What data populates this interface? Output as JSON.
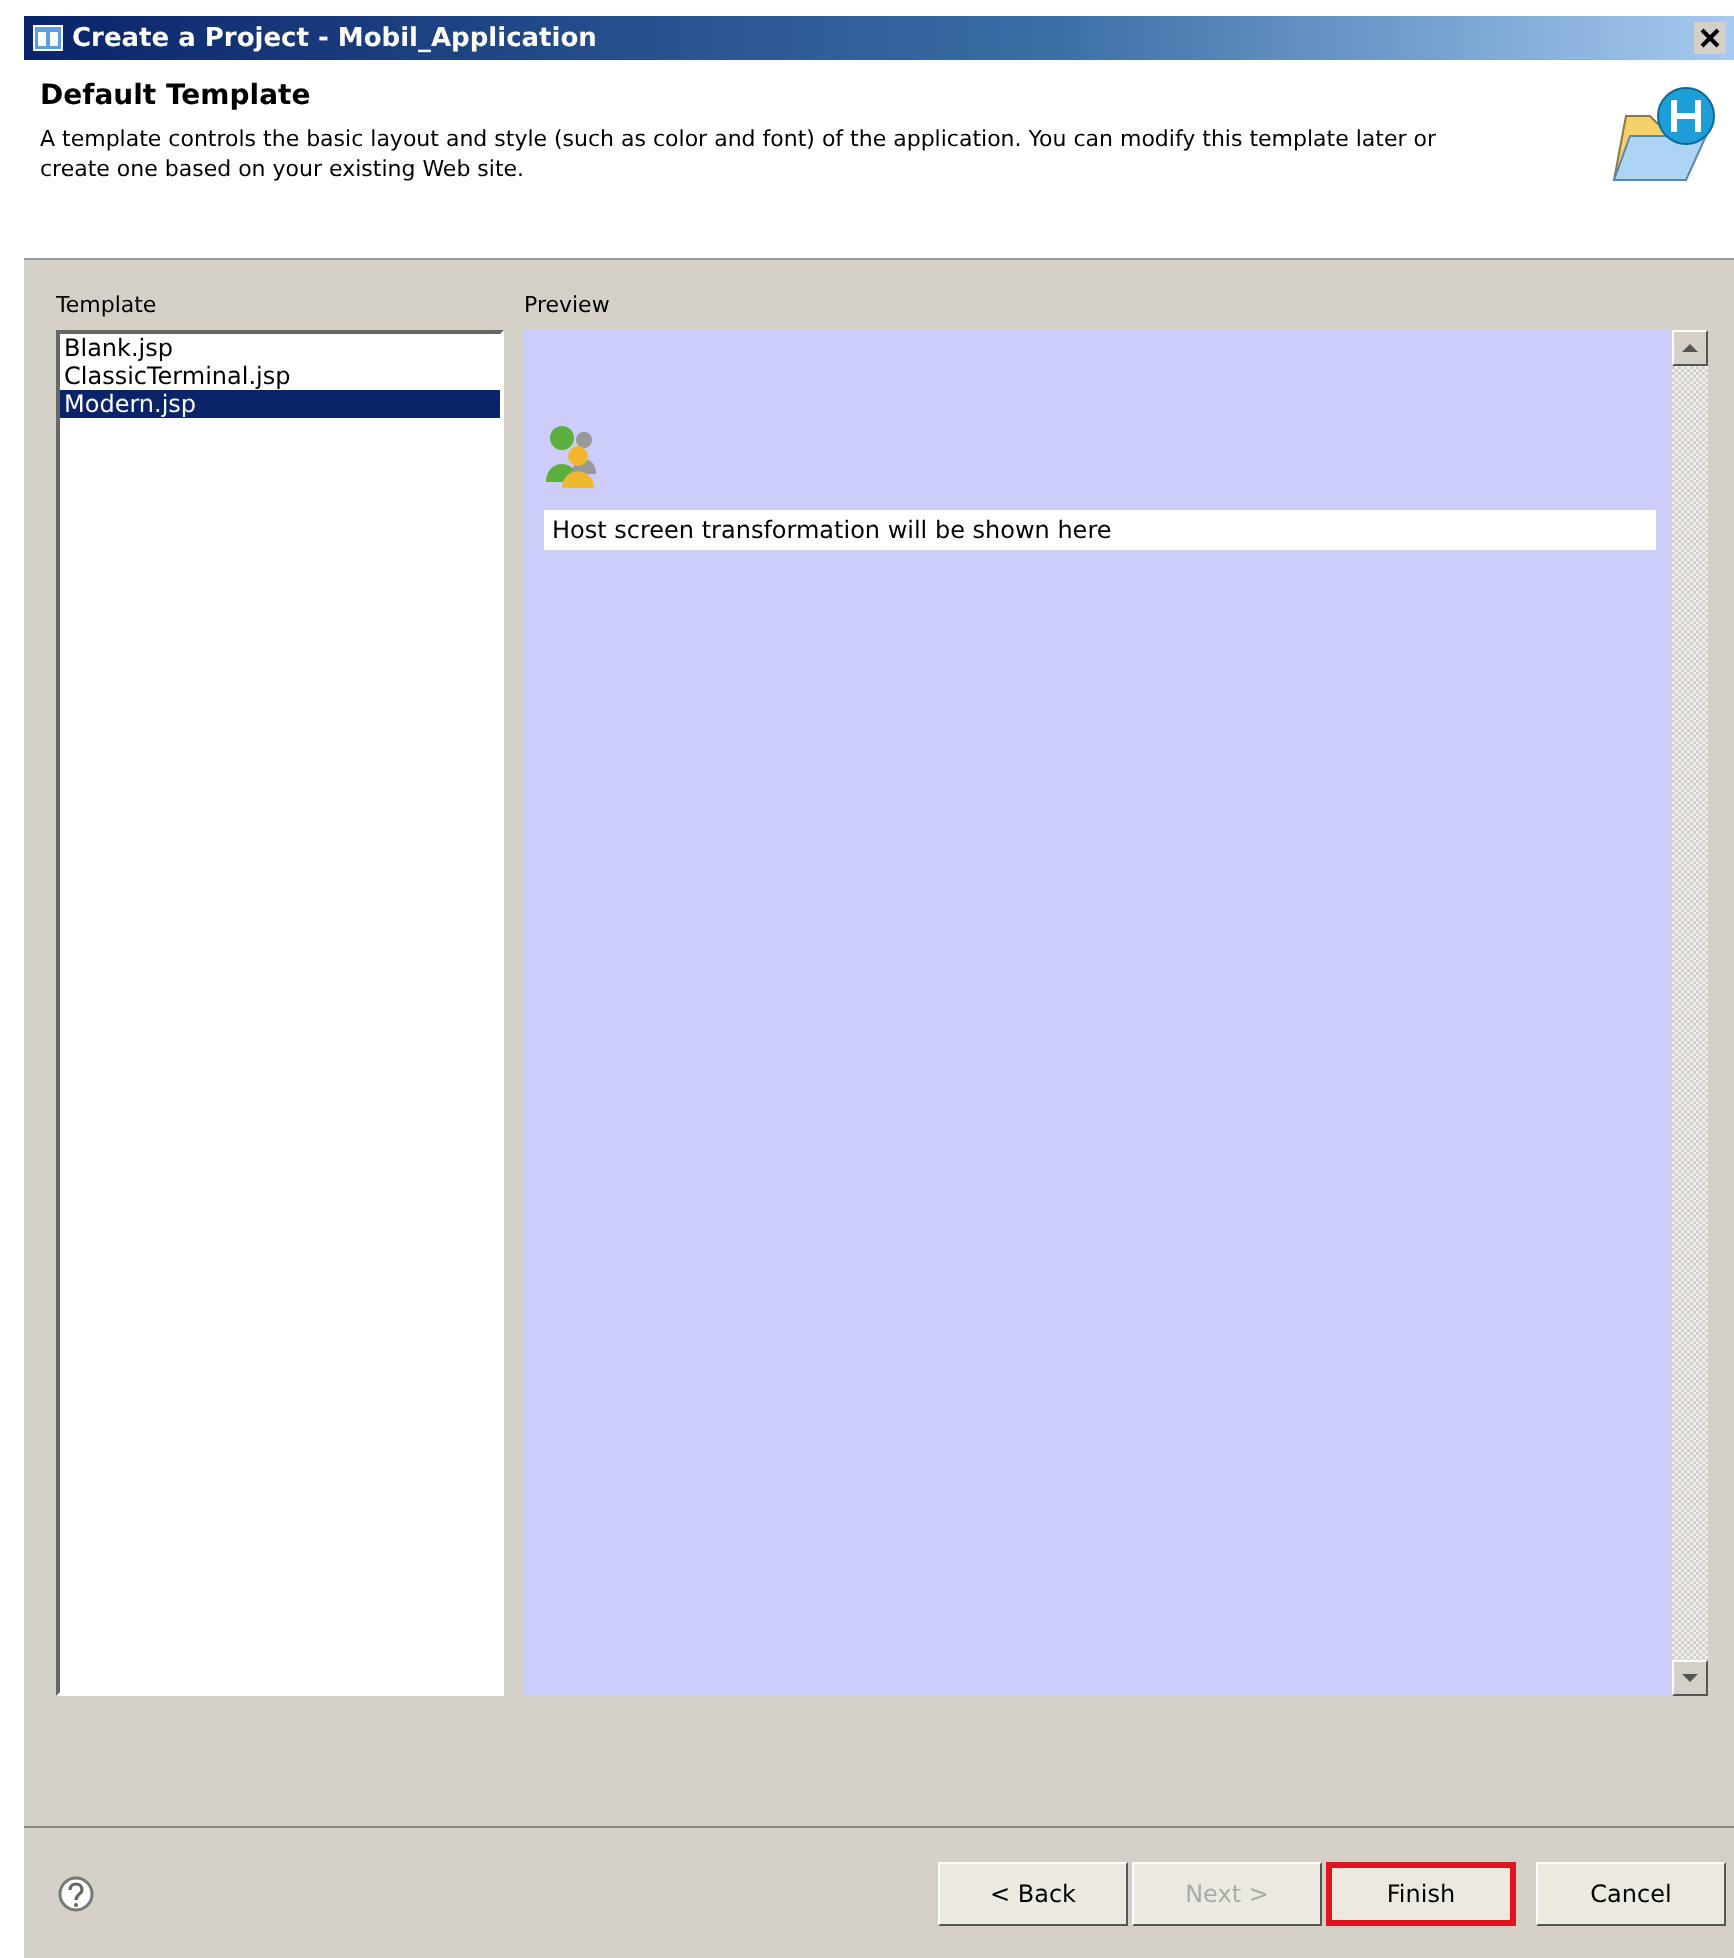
{
  "window": {
    "title": "Create a Project - Mobil_Application"
  },
  "header": {
    "title": "Default Template",
    "description": "A template controls the basic layout and style (such as color and font) of the application. You can modify this template later or create one based on your existing Web site."
  },
  "template_list": {
    "label": "Template",
    "items": [
      {
        "label": "Blank.jsp",
        "selected": false
      },
      {
        "label": "ClassicTerminal.jsp",
        "selected": false
      },
      {
        "label": "Modern.jsp",
        "selected": true
      }
    ]
  },
  "preview": {
    "label": "Preview",
    "message": "Host screen transformation will be shown here"
  },
  "buttons": [
    {
      "label": "< Back",
      "disabled": false,
      "highlighted": false
    },
    {
      "label": "Next >",
      "disabled": true,
      "highlighted": false
    },
    {
      "label": "Finish",
      "disabled": false,
      "highlighted": true
    },
    {
      "label": "Cancel",
      "disabled": false,
      "highlighted": false
    }
  ]
}
